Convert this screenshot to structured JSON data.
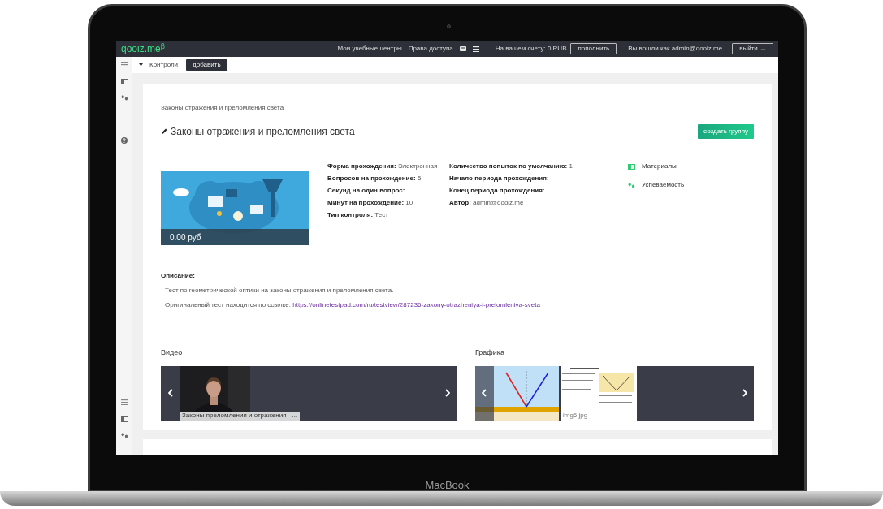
{
  "device": {
    "label": "MacBook"
  },
  "top_bar": {
    "logo": "qooiz.me$^{β}$",
    "nav_links": [
      "Мои учебные центры",
      "Права доступа"
    ],
    "balance": "На вашем счету: 0 RUB",
    "top_up_button": "пополнить",
    "user": "Вы вошли как admin@qooiz.me",
    "logout_button": "выйти →"
  },
  "sub_bar": {
    "section": "Контроли",
    "add_button": "добавить"
  },
  "breadcrumb": "Законы отражения и преломления света",
  "title": "Законы отражения и преломления света",
  "create_group_button": "создать группу",
  "price": "0.00 руб",
  "details": [
    [
      {
        "label": "Форма прохождения:",
        "value": "Электронная"
      },
      {
        "label": "Вопросов на прохождение:",
        "value": "5"
      },
      {
        "label": "Секунд на один вопрос:"
      },
      {
        "label": "Минут на прохождение:",
        "value": "10"
      },
      {
        "label": "Тип контроля:",
        "value": "Тест"
      }
    ],
    [
      {
        "label": "Количество попыток по умолчанию:",
        "value": "1"
      },
      {
        "label": "Начало периода прохождения:"
      },
      {
        "label": "Конец периода прохождения:"
      },
      {
        "label": "Автор:",
        "value": "admin@qooiz.me"
      }
    ]
  ],
  "side_links": [
    {
      "kind": "materials",
      "label": "Материалы"
    },
    {
      "kind": "progress",
      "label": "Успеваемость"
    }
  ],
  "description": {
    "heading": "Описание:",
    "text": "Тест по геометрической оптики на законы отражения и преломления света.",
    "link_intro": "Оригинальный тест находится по ссылке:",
    "link": "https://onlinetestpad.com/ru/testview/287236-zakony-otrazheniya-i-prelomleniya-sveta"
  },
  "galleries": [
    {
      "kind": "video",
      "title": "Видео",
      "items": [
        {
          "caption": "Законы преломления и отражения - ..."
        }
      ]
    },
    {
      "kind": "graphics",
      "title": "Графика",
      "items": [
        {
          "kind": "picture"
        },
        {
          "kind": "picture",
          "caption": "img6.jpg"
        }
      ]
    }
  ]
}
